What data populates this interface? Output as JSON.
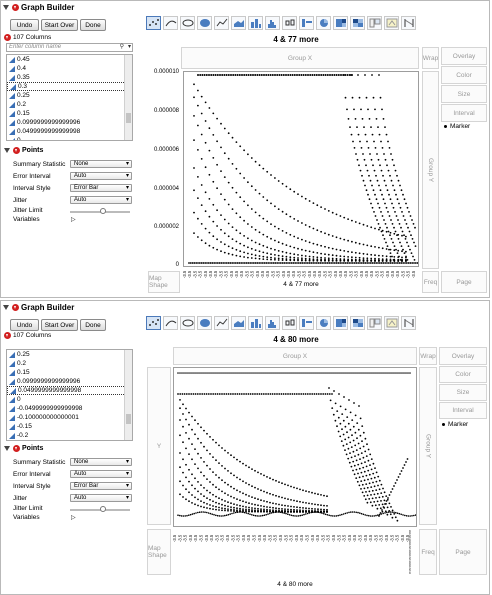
{
  "windows": [
    {
      "title": "Graph Builder",
      "buttons": [
        "Undo",
        "Start Over",
        "Done"
      ],
      "columns_count": "107 Columns",
      "search_placeholder": "Enter column name",
      "column_items": [
        "0.45",
        "0.4",
        "0.35",
        "0.3",
        "0.25",
        "0.2",
        "0.15",
        "0.0999999999999996",
        "0.0499999999999998",
        "0"
      ],
      "selected_item_index": 3,
      "points_header": "Points",
      "props": [
        {
          "label": "Summary Statistic",
          "value": "None"
        },
        {
          "label": "Error Interval",
          "value": "Auto"
        },
        {
          "label": "Interval Style",
          "value": "Error Bar"
        },
        {
          "label": "Jitter",
          "value": "Auto"
        },
        {
          "label": "Jitter Limit",
          "value": ""
        },
        {
          "label": "Variables",
          "value": ""
        }
      ],
      "graph_title": "4 & 77 more",
      "group_x": "Group X",
      "group_y": "Group Y",
      "y_zone": "",
      "x_label": "4 & 77 more",
      "map_shape": "Map Shape",
      "freq": "Freq",
      "page": "Page",
      "wrap": "Wrap",
      "overlay": "Overlay",
      "color": "Color",
      "size": "Size",
      "interval": "Interval",
      "legend": "Marker",
      "y_ticks": [
        "0.000010",
        "0.000008",
        "0.000006",
        "0.000004",
        "0.000002",
        "0"
      ]
    },
    {
      "title": "Graph Builder",
      "buttons": [
        "Undo",
        "Start Over",
        "Done"
      ],
      "columns_count": "107 Columns",
      "search_placeholder": "Enter column name",
      "column_items": [
        "0.25",
        "0.2",
        "0.15",
        "0.0999999999999996",
        "0.0499999999999998",
        "0",
        "-0.0499999999999998",
        "-0.100000000000001",
        "-0.15",
        "-0.2"
      ],
      "selected_item_index": 4,
      "points_header": "Points",
      "props": [
        {
          "label": "Summary Statistic",
          "value": "None"
        },
        {
          "label": "Error Interval",
          "value": "Auto"
        },
        {
          "label": "Interval Style",
          "value": "Error Bar"
        },
        {
          "label": "Jitter",
          "value": "Auto"
        },
        {
          "label": "Jitter Limit",
          "value": ""
        },
        {
          "label": "Variables",
          "value": ""
        }
      ],
      "graph_title": "4 & 80 more",
      "group_x": "Group X",
      "group_y": "Group Y",
      "y_zone": "Y",
      "x_label": "4 & 80 more",
      "map_shape": "Map Shape",
      "freq": "Freq",
      "page": "Page",
      "wrap": "Wrap",
      "overlay": "Overlay",
      "color": "Color",
      "size": "Size",
      "interval": "Interval",
      "legend": "Marker"
    }
  ],
  "colors": {
    "selected_tool": "#d6e4f5",
    "accent_blue": "#3a6fb5",
    "menu_red": "#d21f1f"
  },
  "icons": [
    "disclosure-triangle-icon",
    "red-triangle-menu-icon",
    "search-icon",
    "dropdown-icon",
    "continuous-column-icon"
  ]
}
